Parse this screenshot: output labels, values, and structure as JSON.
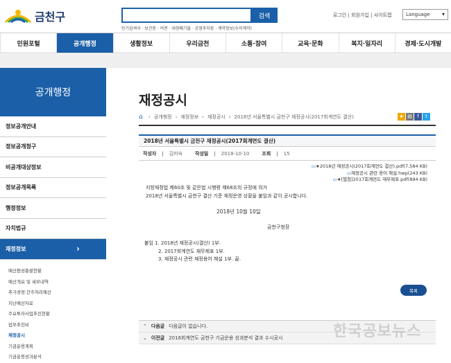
{
  "header": {
    "logo_text": "금천구",
    "search_button": "검색",
    "popular_searches": "인기검색어 · 보건증 · 여권 · 대형폐기물 · 공영주차장 · 계약정보(수의계약)",
    "top_links": "로그인 | 회원가입 | 사이트맵",
    "language": "Language"
  },
  "nav": {
    "items": [
      "민원포털",
      "공개행정",
      "생활정보",
      "우리금천",
      "소통·참여",
      "교육·문화",
      "복지·일자리",
      "경제·도시개발"
    ]
  },
  "sidebar": {
    "title": "공개행정",
    "items": [
      "정보공개안내",
      "정보공개청구",
      "비공개대상정보",
      "정보공개목록",
      "행정정보",
      "자치법규",
      "재정정보"
    ],
    "active_arrow": "›",
    "sub_items": [
      "예산편성총괄현황",
      "예산개요 및 세부내역",
      "추가경정·간주처리예산",
      "지난예산자료",
      "주요투자사업추진현황",
      "업무추진비",
      "재정공시",
      "기금운용계획",
      "기금운용성과분석"
    ]
  },
  "page": {
    "title": "재정공시",
    "breadcrumb": [
      "공개행정",
      "재정정보",
      "재정공시",
      "2018년 서울특별시 금천구 재정공시(2017회계연도 결산)"
    ]
  },
  "article": {
    "title": "2018년 서울특별시 금천구 재정공시(2017회계연도 결산)",
    "author_label": "작성자",
    "author": "김미숙",
    "date_label": "작성일",
    "date": "2018-10-10",
    "views_label": "조회",
    "views": "15",
    "files": [
      "★2018년 재정공시(2017회계연도 결산).pdf(7,584 KB)",
      "재정공시 관련 용어 해설.hwp(243 KB)",
      "★[별첨]2017회계연도 재무제표.pdf(894 KB)"
    ],
    "body_line1": "지방재정법 제60조 및 같은법 시행령 제68조의 규정에 의거",
    "body_line2": "2018년 서울특별시 금천구 결산 기준 재정운영 상황을 붙임과 같이 공시합니다.",
    "sign_date": "2018년  10월  10일",
    "org": "금천구청장",
    "attach": [
      "붙임 1. 2018년 재정공시(결산) 1부.",
      "2. 2017회계연도 재무제표 1부.",
      "3. 재정공시 관련 재정용어 해설 1부.  끝."
    ],
    "list_button": "목록"
  },
  "prevnext": {
    "next_label": "다음글",
    "next_text": "다음글이 없습니다.",
    "prev_label": "이전글",
    "prev_text": "2016회계연도 금천구 기금운용 성과분석 결과 수시공시"
  },
  "watermark": "한국공보뉴스",
  "colors": {
    "primary": "#1a5fa8",
    "dark_button": "#1a4f92"
  }
}
